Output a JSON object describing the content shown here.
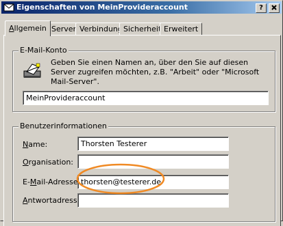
{
  "window": {
    "title": "Eigenschaften von MeinProvideraccount",
    "help_button": "?",
    "close_button": "X",
    "title_icon": "mail-account-icon"
  },
  "tabs": [
    {
      "label": "Allgemein",
      "active": true
    },
    {
      "label": "Server",
      "active": false
    },
    {
      "label": "Verbindung",
      "active": false
    },
    {
      "label": "Sicherheit",
      "active": false
    },
    {
      "label": "Erweitert",
      "active": false
    }
  ],
  "email_account": {
    "legend": "E-Mail-Konto",
    "icon": "mail-server-icon",
    "description": "Geben Sie einen Namen an, über den Sie auf diesen Server zugreifen möchten, z.B. \"Arbeit\" oder \"Microsoft Mail-Server\".",
    "account_name": "MeinProvideraccount"
  },
  "user_info": {
    "legend": "Benutzerinformationen",
    "name": {
      "label": "Name:",
      "value": "Thorsten Testerer"
    },
    "organization": {
      "label": "Organisation:",
      "value": ""
    },
    "email": {
      "label": "E-Mail-Adresse:",
      "value": "thorsten@testerer.de"
    },
    "reply": {
      "label": "Antwortadresse:",
      "value": ""
    }
  },
  "highlight_color": "#f08a24",
  "titlebar_color": "#0a246a"
}
